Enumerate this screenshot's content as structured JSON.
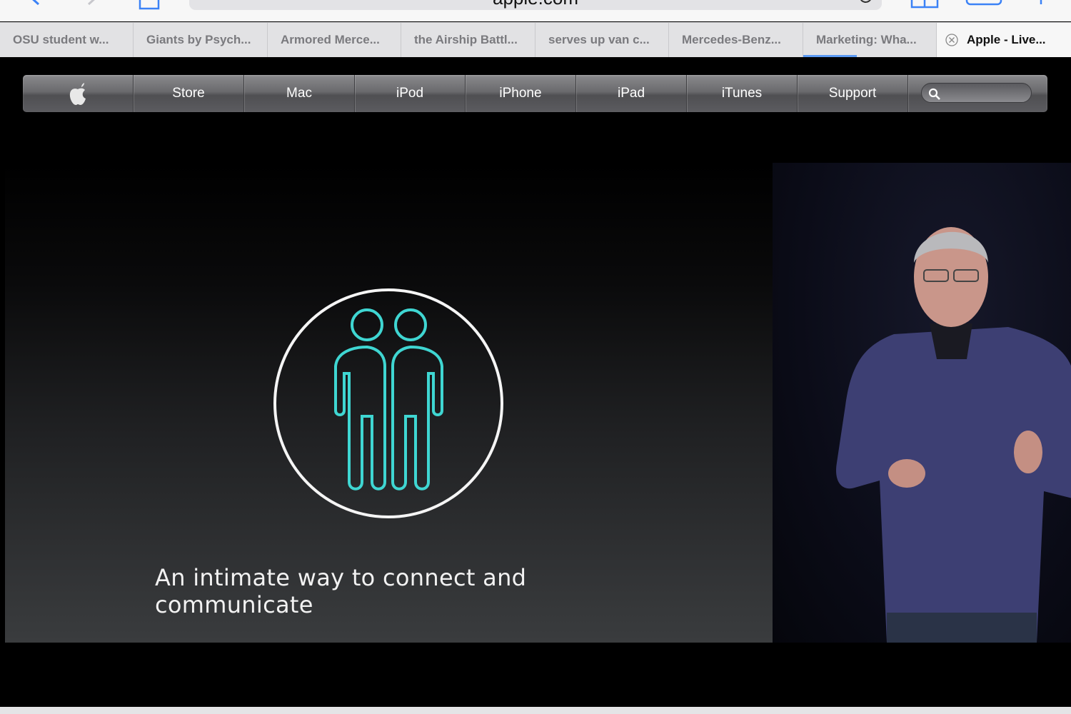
{
  "browser": {
    "url": "apple.com",
    "icons": [
      "back-icon",
      "forward-icon",
      "share-icon",
      "reload-icon",
      "bookmarks-icon",
      "tabs-icon",
      "new-tab-icon"
    ]
  },
  "tabs": [
    {
      "label": "OSU student w..."
    },
    {
      "label": "Giants by Psych..."
    },
    {
      "label": "Armored Merce..."
    },
    {
      "label": "the Airship Battl..."
    },
    {
      "label": "serves up van c..."
    },
    {
      "label": "Mercedes-Benz..."
    },
    {
      "label": "Marketing: Wha..."
    },
    {
      "label": "Apple - Live...",
      "active": true
    }
  ],
  "globalnav": {
    "items": [
      "Store",
      "Mac",
      "iPod",
      "iPhone",
      "iPad",
      "iTunes",
      "Support"
    ],
    "search_placeholder": ""
  },
  "video": {
    "caption": "An intimate way to connect and communicate"
  },
  "colors": {
    "accent_blue": "#5b9af3",
    "emblem_teal": "#3fd6d2",
    "nav_gray": "#6a6a6d"
  }
}
